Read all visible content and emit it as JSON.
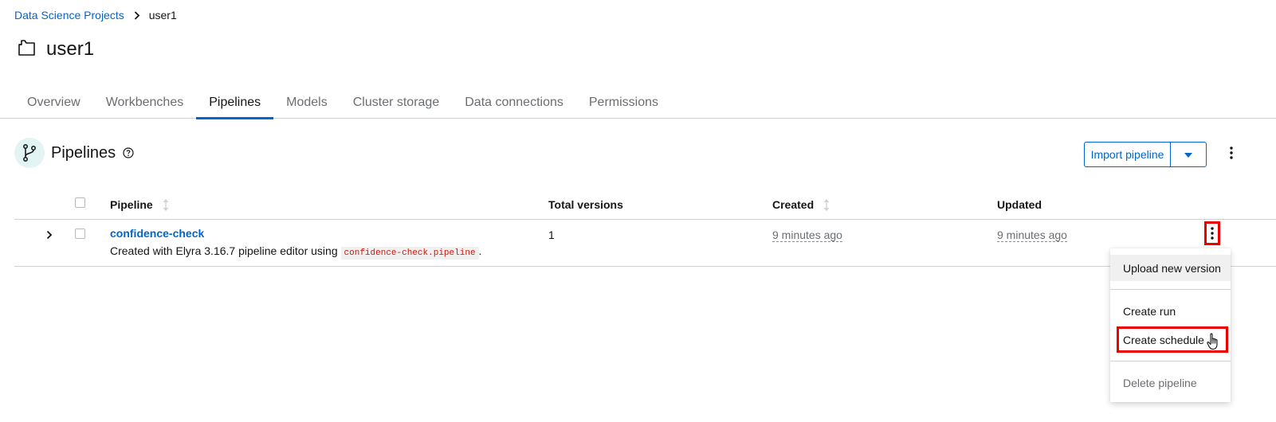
{
  "breadcrumb": {
    "parent": "Data Science Projects",
    "current": "user1"
  },
  "project": {
    "title": "user1",
    "icon": "project-folder-icon"
  },
  "tabs": [
    {
      "label": "Overview",
      "active": false
    },
    {
      "label": "Workbenches",
      "active": false
    },
    {
      "label": "Pipelines",
      "active": true
    },
    {
      "label": "Models",
      "active": false
    },
    {
      "label": "Cluster storage",
      "active": false
    },
    {
      "label": "Data connections",
      "active": false
    },
    {
      "label": "Permissions",
      "active": false
    }
  ],
  "section": {
    "title": "Pipelines",
    "import_label": "Import pipeline"
  },
  "table": {
    "columns": {
      "pipeline": "Pipeline",
      "versions": "Total versions",
      "created": "Created",
      "updated": "Updated"
    },
    "rows": [
      {
        "name": "confidence-check",
        "description_prefix": "Created with Elyra 3.16.7 pipeline editor using",
        "description_code": "confidence-check.pipeline",
        "description_suffix": ".",
        "versions": "1",
        "created": "9 minutes ago",
        "updated": "9 minutes ago"
      }
    ]
  },
  "menu": {
    "upload": "Upload new version",
    "create_run": "Create run",
    "create_schedule": "Create schedule",
    "delete": "Delete pipeline"
  },
  "colors": {
    "link": "#0066cc",
    "highlight": "#ee0000",
    "code": "#c9190b"
  }
}
